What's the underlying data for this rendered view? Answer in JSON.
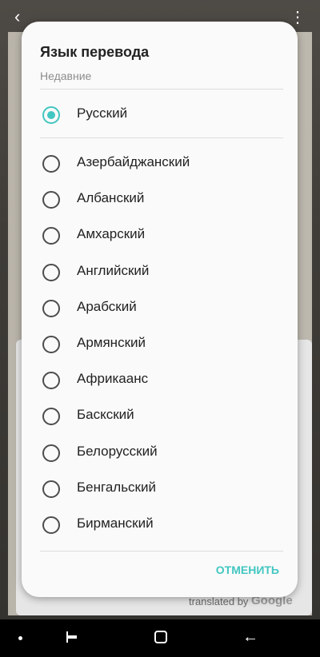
{
  "dialog": {
    "title": "Язык перевода",
    "recent_header": "Недавние",
    "recent_languages": [
      {
        "label": "Русский",
        "selected": true
      }
    ],
    "languages": [
      {
        "label": "Азербайджанский",
        "selected": false
      },
      {
        "label": "Албанский",
        "selected": false
      },
      {
        "label": "Амхарский",
        "selected": false
      },
      {
        "label": "Английский",
        "selected": false
      },
      {
        "label": "Арабский",
        "selected": false
      },
      {
        "label": "Армянский",
        "selected": false
      },
      {
        "label": "Африкаанс",
        "selected": false
      },
      {
        "label": "Баскский",
        "selected": false
      },
      {
        "label": "Белорусский",
        "selected": false
      },
      {
        "label": "Бенгальский",
        "selected": false
      },
      {
        "label": "Бирманский",
        "selected": false
      }
    ],
    "cancel_label": "ОТМЕНИТЬ"
  },
  "background": {
    "translated_by": "translated by",
    "google_logo": "Google"
  },
  "colors": {
    "accent": "#42c6c1",
    "dialog_bg": "#fafafa",
    "navbar_bg": "#000000"
  },
  "icons": {
    "back": "back-arrow-icon",
    "more": "more-vert-icon",
    "nav_recent": "recent-apps-icon",
    "nav_home": "home-icon",
    "nav_back": "nav-back-icon"
  }
}
